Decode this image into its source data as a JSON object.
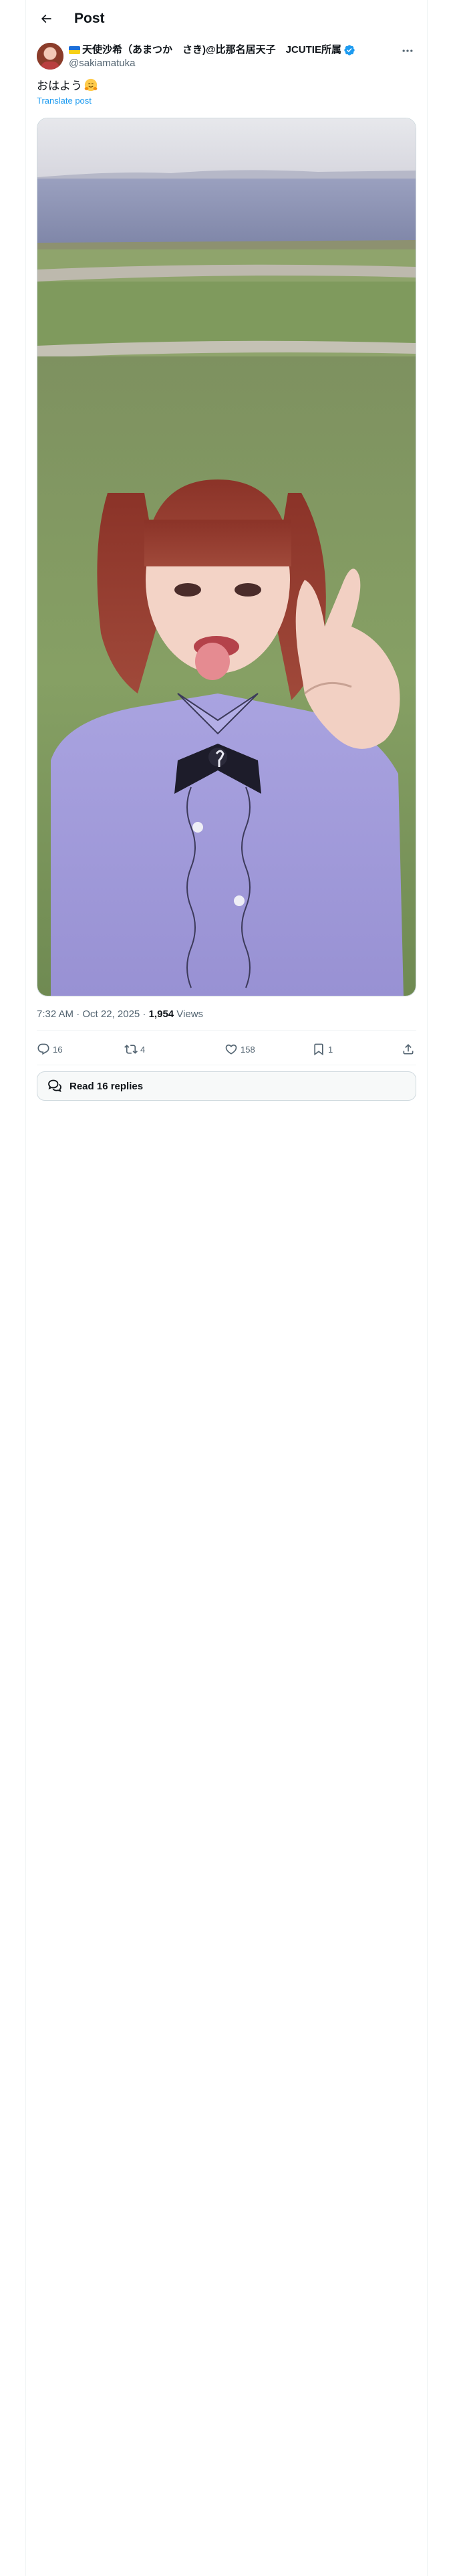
{
  "header": {
    "title": "Post",
    "back_icon": "arrow-left-icon"
  },
  "author": {
    "display_name": "天使沙希（あまつか　さき)@比那名居天子　JCUTIE所属",
    "handle": "@sakiamatuka",
    "verified": true,
    "flag_icon": "ukraine-flag-icon",
    "more_icon": "more-horizontal-icon"
  },
  "post": {
    "text": "おはよう",
    "emoji_icon": "hugging-face-emoji-icon",
    "translate_label": "Translate post",
    "timestamp": "7:32 AM · Oct 22, 2025 · ",
    "views_count": "1,954",
    "views_label": " Views"
  },
  "actions": {
    "replies": "16",
    "reposts": "4",
    "likes": "158",
    "bookmarks": "1"
  },
  "read_replies": {
    "label": "Read 16 replies"
  },
  "colors": {
    "accent": "#1d9bf0",
    "muted": "#536471",
    "text": "#0f1419",
    "border": "#cfd9de"
  }
}
